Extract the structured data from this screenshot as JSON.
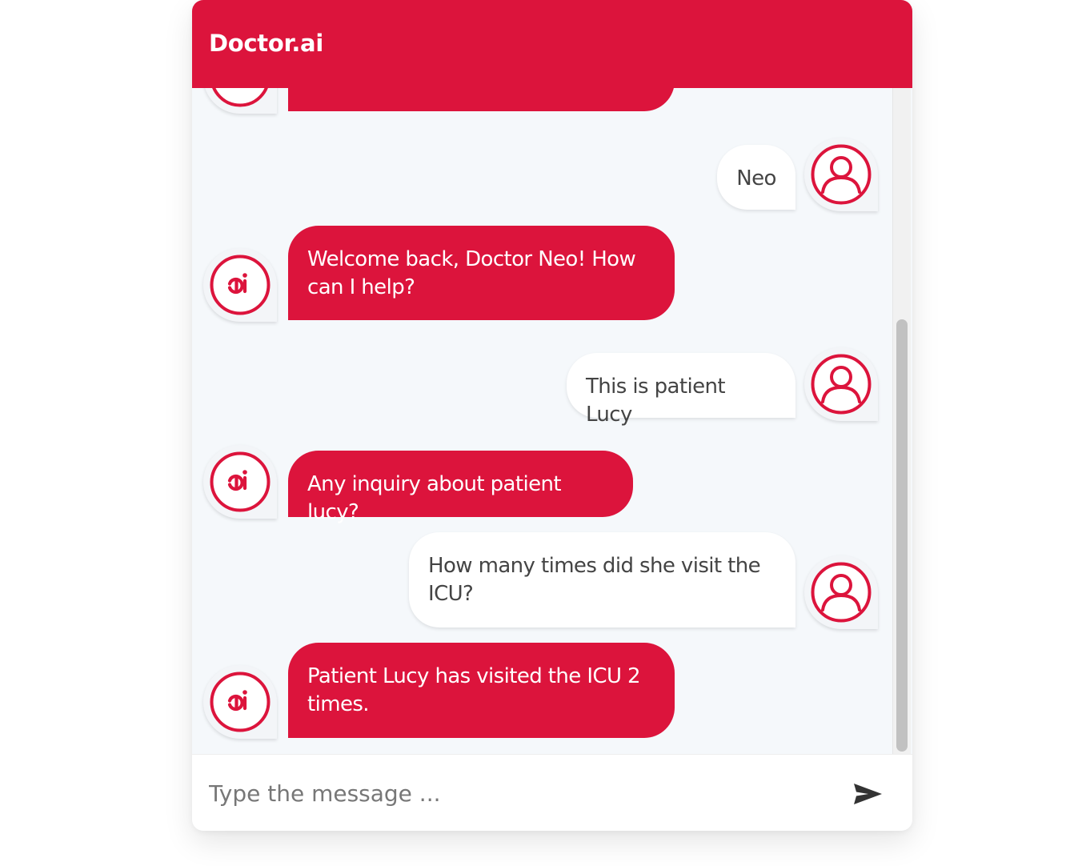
{
  "header": {
    "title": "Doctor.ai"
  },
  "messages": [
    {
      "sender": "bot",
      "text": ""
    },
    {
      "sender": "user",
      "text": "Neo"
    },
    {
      "sender": "bot",
      "text": "Welcome back, Doctor Neo! How can I help?"
    },
    {
      "sender": "user",
      "text": "This is patient Lucy"
    },
    {
      "sender": "bot",
      "text": "Any inquiry about patient lucy?"
    },
    {
      "sender": "user",
      "text": "How many times did she visit the ICU?"
    },
    {
      "sender": "bot",
      "text": "Patient Lucy has visited the ICU 2 times."
    }
  ],
  "avatars": {
    "bot_icon": "ai-logo-icon",
    "user_icon": "user-icon"
  },
  "input": {
    "placeholder": "Type the message ..."
  },
  "send": {
    "icon": "send-icon"
  },
  "colors": {
    "accent": "#dc143c",
    "background": "#f5f8fb",
    "user_bubble": "#ffffff",
    "user_text": "#444444"
  }
}
